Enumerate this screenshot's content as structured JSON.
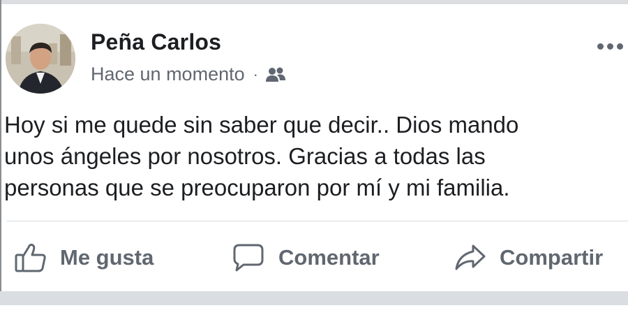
{
  "post": {
    "author": "Peña Carlos",
    "timestamp": "Hace un momento",
    "separator": "·",
    "audience_icon": "friends-icon",
    "more_icon": "more-options-icon",
    "text": "Hoy si me quede sin saber que decir.. Dios mando\nunos ángeles por nosotros. Gracias a todas las\npersonas que se preocuparon por mí y mi familia."
  },
  "actions": {
    "like_label": "Me gusta",
    "comment_label": "Comentar",
    "share_label": "Compartir"
  },
  "colors": {
    "text_primary": "#1c1e21",
    "text_secondary": "#606770",
    "divider": "#d8dade"
  }
}
